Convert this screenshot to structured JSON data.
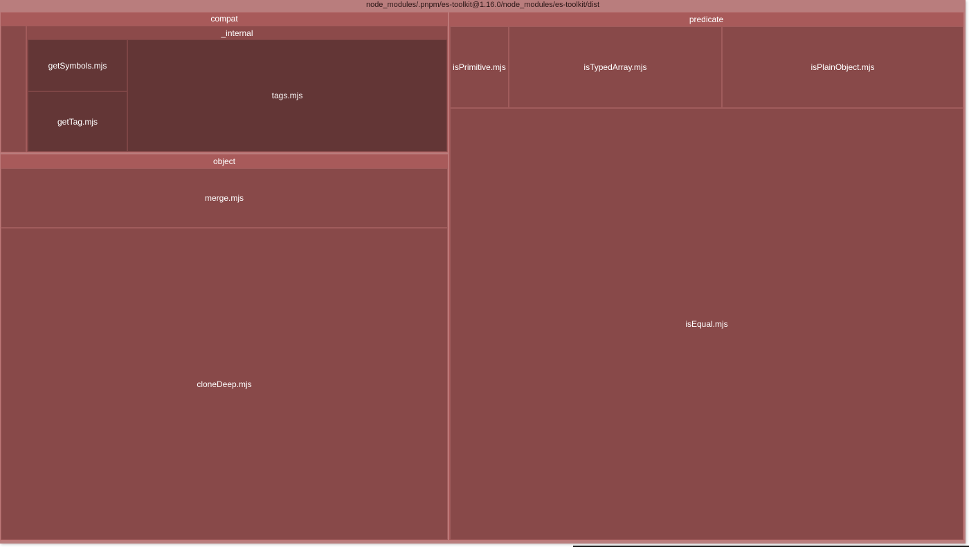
{
  "root": {
    "path": "node_modules/.pnpm/es-toolkit@1.16.0/node_modules/es-toolkit/dist"
  },
  "groups": {
    "compat": {
      "title": "compat",
      "internal": {
        "title": "_internal",
        "files": {
          "getSymbols": "getSymbols.mjs",
          "getTag": "getTag.mjs",
          "tags": "tags.mjs"
        }
      }
    },
    "object": {
      "title": "object",
      "files": {
        "merge": "merge.mjs",
        "cloneDeep": "cloneDeep.mjs"
      }
    },
    "predicate": {
      "title": "predicate",
      "files": {
        "isPrimitive": "isPrimitive.mjs",
        "isTypedArray": "isTypedArray.mjs",
        "isPlainObject": "isPlainObject.mjs",
        "isEqual": "isEqual.mjs"
      }
    }
  },
  "colors": {
    "root": "#b97d7d",
    "group_header": "#a85a5a",
    "leaf": "#884949",
    "leaf_dark": "#633636"
  }
}
